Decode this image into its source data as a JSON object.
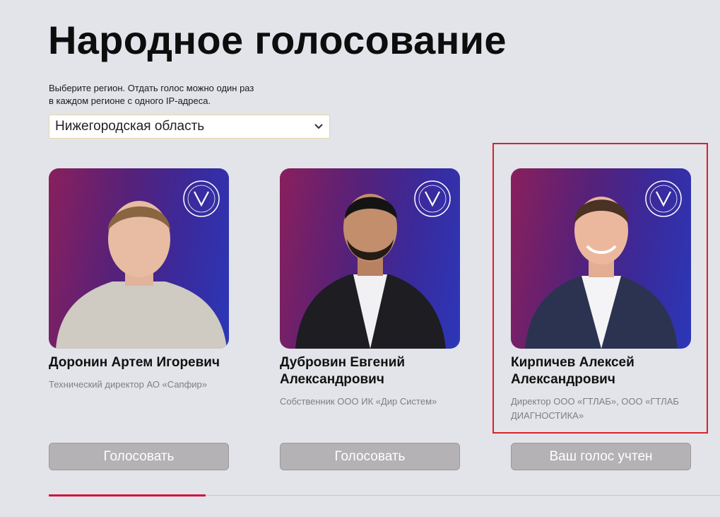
{
  "page": {
    "title": "Народное голосование",
    "hint": "Выберите регион. Отдать голос можно один раз в каждом регионе с одного IP-адреса."
  },
  "region_select": {
    "value": "Нижегородская область",
    "icon": "chevron-down-icon"
  },
  "candidates": [
    {
      "name": "Доронин Артем Игоревич",
      "role": "Технический директор АО «Сапфир»",
      "button": "Голосовать"
    },
    {
      "name": "Дубровин Евгений Александрович",
      "role": "Собственник ООО ИК «Дир Систем»",
      "button": "Голосовать"
    },
    {
      "name": "Кирпичев Алексей Александрович",
      "role": "Директор ООО «ГТЛАБ», ООО «ГТЛАБ ДИАГНОСТИКА»",
      "button": "Ваш голос учтен"
    }
  ],
  "colors": {
    "accent": "#d1163f",
    "highlight": "#d6232a",
    "button_bg": "#b5b2b5",
    "background": "#e2e4e9"
  }
}
